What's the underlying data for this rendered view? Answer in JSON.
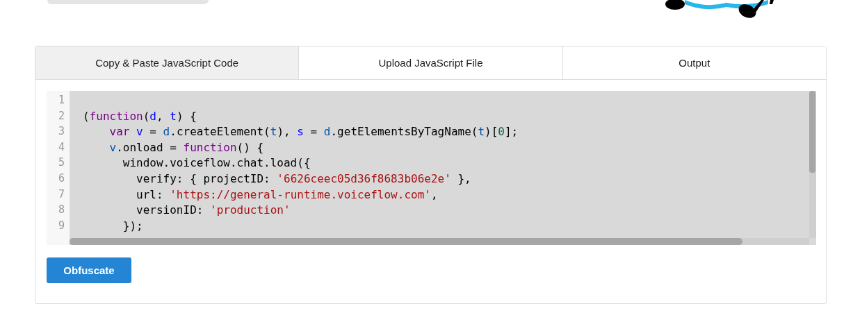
{
  "tabs": [
    {
      "label": "Copy & Paste JavaScript Code",
      "selected": true
    },
    {
      "label": "Upload JavaScript File",
      "selected": false
    },
    {
      "label": "Output",
      "selected": false
    }
  ],
  "editor": {
    "lines": [
      {
        "number": "1"
      },
      {
        "number": "2",
        "tokens": [
          {
            "text": "(",
            "kind": "plain"
          },
          {
            "text": "function",
            "kind": "keyword"
          },
          {
            "text": "(",
            "kind": "plain"
          },
          {
            "text": "d",
            "kind": "def"
          },
          {
            "text": ", ",
            "kind": "plain"
          },
          {
            "text": "t",
            "kind": "def"
          },
          {
            "text": ") {",
            "kind": "plain"
          }
        ]
      },
      {
        "number": "3",
        "tokens": [
          {
            "text": "    var",
            "kind": "keyword"
          },
          {
            "text": " v",
            "kind": "def"
          },
          {
            "text": " = ",
            "kind": "plain"
          },
          {
            "text": "d",
            "kind": "variable"
          },
          {
            "text": ".createElement(",
            "kind": "plain"
          },
          {
            "text": "t",
            "kind": "variable"
          },
          {
            "text": "), ",
            "kind": "plain"
          },
          {
            "text": "s",
            "kind": "def"
          },
          {
            "text": " = ",
            "kind": "plain"
          },
          {
            "text": "d",
            "kind": "variable"
          },
          {
            "text": ".getElementsByTagName(",
            "kind": "plain"
          },
          {
            "text": "t",
            "kind": "variable"
          },
          {
            "text": ")[",
            "kind": "plain"
          },
          {
            "text": "0",
            "kind": "number"
          },
          {
            "text": "];",
            "kind": "plain"
          }
        ]
      },
      {
        "number": "4",
        "tokens": [
          {
            "text": "    v",
            "kind": "variable"
          },
          {
            "text": ".onload = ",
            "kind": "plain"
          },
          {
            "text": "function",
            "kind": "keyword"
          },
          {
            "text": "() {",
            "kind": "plain"
          }
        ]
      },
      {
        "number": "5",
        "tokens": [
          {
            "text": "      window.voiceflow.chat.load({",
            "kind": "plain"
          }
        ]
      },
      {
        "number": "6",
        "tokens": [
          {
            "text": "        verify: { projectID: ",
            "kind": "plain"
          },
          {
            "text": "'6626ceec05d36f8683b06e2e'",
            "kind": "string"
          },
          {
            "text": " },",
            "kind": "plain"
          }
        ]
      },
      {
        "number": "7",
        "tokens": [
          {
            "text": "        url: ",
            "kind": "plain"
          },
          {
            "text": "'https://general-runtime.voiceflow.com'",
            "kind": "string"
          },
          {
            "text": ",",
            "kind": "plain"
          }
        ]
      },
      {
        "number": "8",
        "tokens": [
          {
            "text": "        versionID: ",
            "kind": "plain"
          },
          {
            "text": "'production'",
            "kind": "string"
          }
        ]
      },
      {
        "number": "9",
        "tokens": [
          {
            "text": "      });",
            "kind": "plain"
          }
        ]
      }
    ]
  },
  "button": {
    "label": "Obfuscate"
  }
}
